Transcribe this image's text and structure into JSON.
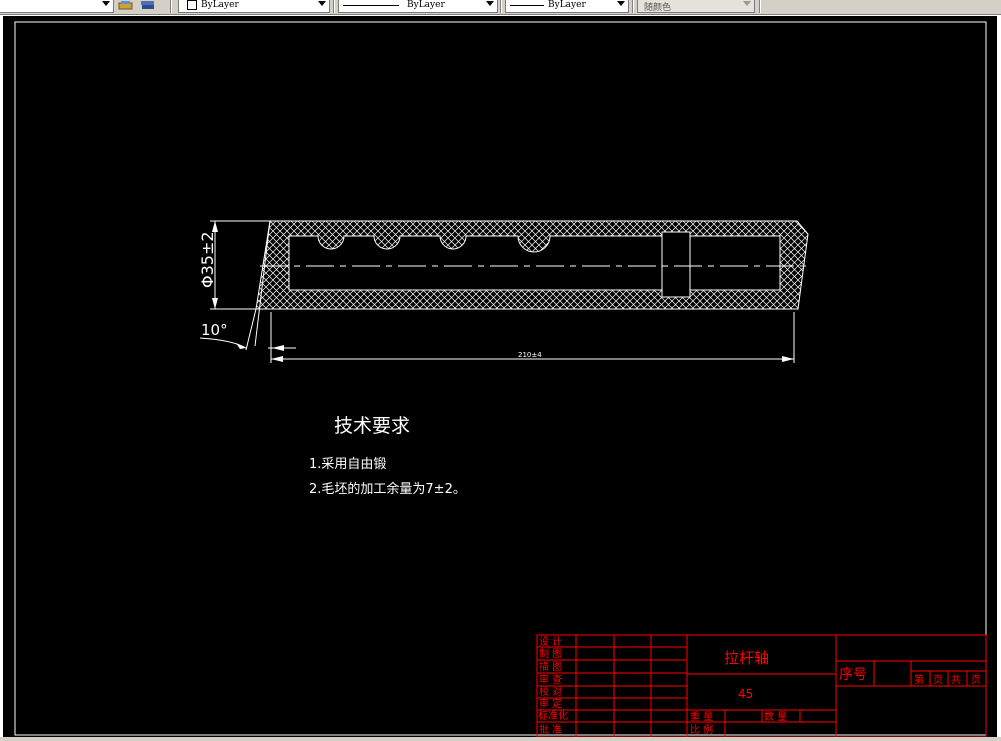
{
  "toolbar": {
    "layer_color": "ByLayer",
    "linetype": "ByLayer",
    "lineweight": "ByLayer",
    "plot_style": "随颜色"
  },
  "drawing": {
    "diameter_dim": "Φ35±2",
    "angle_dim": "10°",
    "length_dim": "210±4",
    "tech_title": "技术要求",
    "req_1": "1.采用自由锻",
    "req_2": "2.毛坯的加工余量为7±2。",
    "colors": {
      "background": "#000000",
      "geometry": "#ffffff",
      "title_block": "#ff0000"
    }
  },
  "title_block": {
    "part_name": "拉杆轴",
    "material": "45",
    "serial_label": "序号",
    "row_labels": [
      "设 计",
      "制 图",
      "描 图",
      "审 查",
      "校 对",
      "审 定",
      "标准化",
      "批 准"
    ],
    "weight_label": "重 量",
    "qty_label": "数 量",
    "scale_label": "比 例",
    "sheet_labels": [
      "第",
      "页",
      "共",
      "页"
    ]
  }
}
